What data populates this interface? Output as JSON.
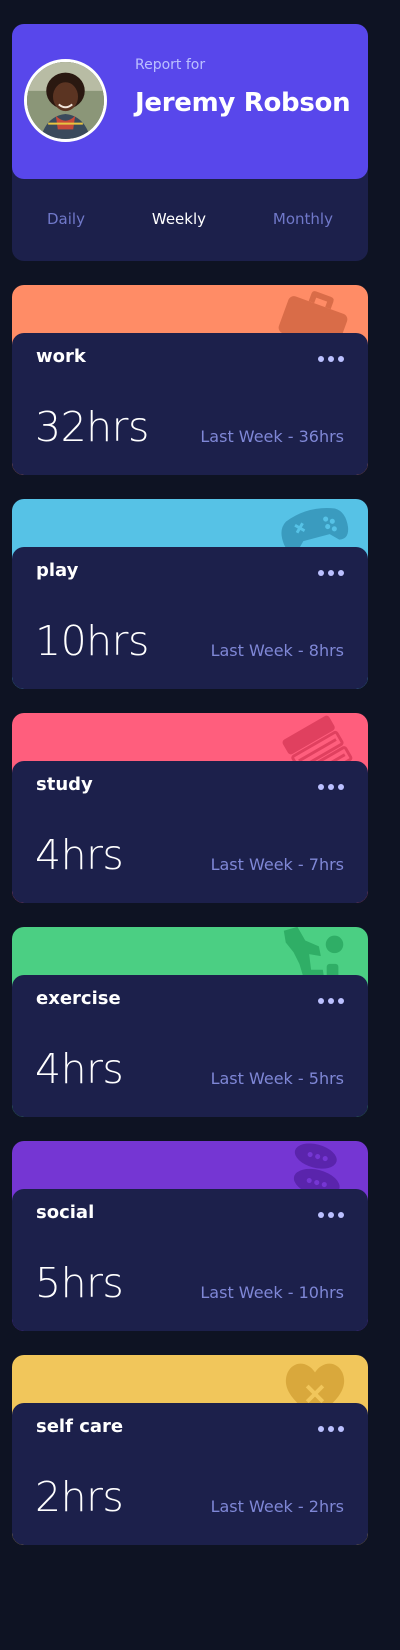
{
  "profile": {
    "report_for": "Report for",
    "name": "Jeremy Robson",
    "avatar": "avatar-photo"
  },
  "tabs": [
    {
      "label": "Daily",
      "active": false
    },
    {
      "label": "Weekly",
      "active": true
    },
    {
      "label": "Monthly",
      "active": false
    }
  ],
  "activities": [
    {
      "title": "work",
      "hours": "32hrs",
      "previous": "Last Week - 36hrs",
      "color": "#ff8c66",
      "icon": "briefcase-icon"
    },
    {
      "title": "play",
      "hours": "10hrs",
      "previous": "Last Week - 8hrs",
      "color": "#56c2e6",
      "icon": "gamepad-icon"
    },
    {
      "title": "study",
      "hours": "4hrs",
      "previous": "Last Week - 7hrs",
      "color": "#ff5e7d",
      "icon": "books-icon"
    },
    {
      "title": "exercise",
      "hours": "4hrs",
      "previous": "Last Week - 5hrs",
      "color": "#4bcf83",
      "icon": "running-person-icon"
    },
    {
      "title": "social",
      "hours": "5hrs",
      "previous": "Last Week - 10hrs",
      "color": "#7536d3",
      "icon": "chat-bubbles-icon"
    },
    {
      "title": "self care",
      "hours": "2hrs",
      "previous": "Last Week - 2hrs",
      "color": "#f1c65b",
      "icon": "heart-icon"
    }
  ],
  "colors": {
    "page_bg": "#0e1323",
    "card_bg": "#1c204b",
    "primary": "#5847eb",
    "muted_text": "#7f87d6"
  }
}
